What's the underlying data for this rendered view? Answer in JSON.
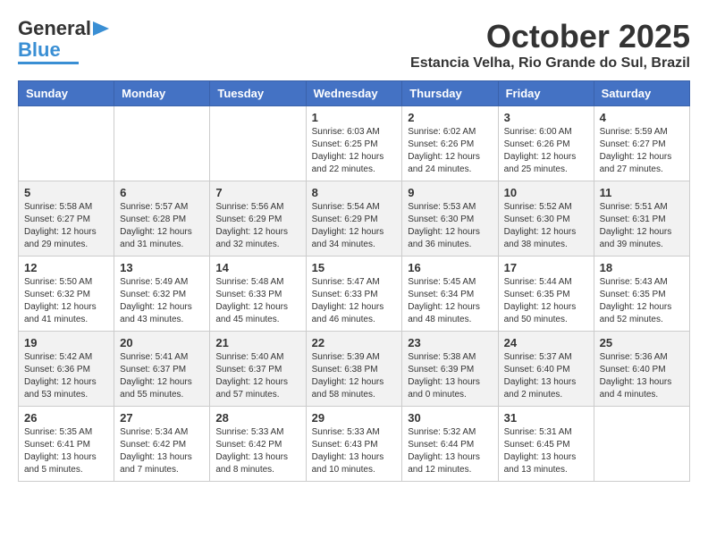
{
  "header": {
    "logo_line1": "General",
    "logo_line2": "Blue",
    "month": "October 2025",
    "location": "Estancia Velha, Rio Grande do Sul, Brazil"
  },
  "weekdays": [
    "Sunday",
    "Monday",
    "Tuesday",
    "Wednesday",
    "Thursday",
    "Friday",
    "Saturday"
  ],
  "weeks": [
    [
      {
        "day": "",
        "info": ""
      },
      {
        "day": "",
        "info": ""
      },
      {
        "day": "",
        "info": ""
      },
      {
        "day": "1",
        "info": "Sunrise: 6:03 AM\nSunset: 6:25 PM\nDaylight: 12 hours\nand 22 minutes."
      },
      {
        "day": "2",
        "info": "Sunrise: 6:02 AM\nSunset: 6:26 PM\nDaylight: 12 hours\nand 24 minutes."
      },
      {
        "day": "3",
        "info": "Sunrise: 6:00 AM\nSunset: 6:26 PM\nDaylight: 12 hours\nand 25 minutes."
      },
      {
        "day": "4",
        "info": "Sunrise: 5:59 AM\nSunset: 6:27 PM\nDaylight: 12 hours\nand 27 minutes."
      }
    ],
    [
      {
        "day": "5",
        "info": "Sunrise: 5:58 AM\nSunset: 6:27 PM\nDaylight: 12 hours\nand 29 minutes."
      },
      {
        "day": "6",
        "info": "Sunrise: 5:57 AM\nSunset: 6:28 PM\nDaylight: 12 hours\nand 31 minutes."
      },
      {
        "day": "7",
        "info": "Sunrise: 5:56 AM\nSunset: 6:29 PM\nDaylight: 12 hours\nand 32 minutes."
      },
      {
        "day": "8",
        "info": "Sunrise: 5:54 AM\nSunset: 6:29 PM\nDaylight: 12 hours\nand 34 minutes."
      },
      {
        "day": "9",
        "info": "Sunrise: 5:53 AM\nSunset: 6:30 PM\nDaylight: 12 hours\nand 36 minutes."
      },
      {
        "day": "10",
        "info": "Sunrise: 5:52 AM\nSunset: 6:30 PM\nDaylight: 12 hours\nand 38 minutes."
      },
      {
        "day": "11",
        "info": "Sunrise: 5:51 AM\nSunset: 6:31 PM\nDaylight: 12 hours\nand 39 minutes."
      }
    ],
    [
      {
        "day": "12",
        "info": "Sunrise: 5:50 AM\nSunset: 6:32 PM\nDaylight: 12 hours\nand 41 minutes."
      },
      {
        "day": "13",
        "info": "Sunrise: 5:49 AM\nSunset: 6:32 PM\nDaylight: 12 hours\nand 43 minutes."
      },
      {
        "day": "14",
        "info": "Sunrise: 5:48 AM\nSunset: 6:33 PM\nDaylight: 12 hours\nand 45 minutes."
      },
      {
        "day": "15",
        "info": "Sunrise: 5:47 AM\nSunset: 6:33 PM\nDaylight: 12 hours\nand 46 minutes."
      },
      {
        "day": "16",
        "info": "Sunrise: 5:45 AM\nSunset: 6:34 PM\nDaylight: 12 hours\nand 48 minutes."
      },
      {
        "day": "17",
        "info": "Sunrise: 5:44 AM\nSunset: 6:35 PM\nDaylight: 12 hours\nand 50 minutes."
      },
      {
        "day": "18",
        "info": "Sunrise: 5:43 AM\nSunset: 6:35 PM\nDaylight: 12 hours\nand 52 minutes."
      }
    ],
    [
      {
        "day": "19",
        "info": "Sunrise: 5:42 AM\nSunset: 6:36 PM\nDaylight: 12 hours\nand 53 minutes."
      },
      {
        "day": "20",
        "info": "Sunrise: 5:41 AM\nSunset: 6:37 PM\nDaylight: 12 hours\nand 55 minutes."
      },
      {
        "day": "21",
        "info": "Sunrise: 5:40 AM\nSunset: 6:37 PM\nDaylight: 12 hours\nand 57 minutes."
      },
      {
        "day": "22",
        "info": "Sunrise: 5:39 AM\nSunset: 6:38 PM\nDaylight: 12 hours\nand 58 minutes."
      },
      {
        "day": "23",
        "info": "Sunrise: 5:38 AM\nSunset: 6:39 PM\nDaylight: 13 hours\nand 0 minutes."
      },
      {
        "day": "24",
        "info": "Sunrise: 5:37 AM\nSunset: 6:40 PM\nDaylight: 13 hours\nand 2 minutes."
      },
      {
        "day": "25",
        "info": "Sunrise: 5:36 AM\nSunset: 6:40 PM\nDaylight: 13 hours\nand 4 minutes."
      }
    ],
    [
      {
        "day": "26",
        "info": "Sunrise: 5:35 AM\nSunset: 6:41 PM\nDaylight: 13 hours\nand 5 minutes."
      },
      {
        "day": "27",
        "info": "Sunrise: 5:34 AM\nSunset: 6:42 PM\nDaylight: 13 hours\nand 7 minutes."
      },
      {
        "day": "28",
        "info": "Sunrise: 5:33 AM\nSunset: 6:42 PM\nDaylight: 13 hours\nand 8 minutes."
      },
      {
        "day": "29",
        "info": "Sunrise: 5:33 AM\nSunset: 6:43 PM\nDaylight: 13 hours\nand 10 minutes."
      },
      {
        "day": "30",
        "info": "Sunrise: 5:32 AM\nSunset: 6:44 PM\nDaylight: 13 hours\nand 12 minutes."
      },
      {
        "day": "31",
        "info": "Sunrise: 5:31 AM\nSunset: 6:45 PM\nDaylight: 13 hours\nand 13 minutes."
      },
      {
        "day": "",
        "info": ""
      }
    ]
  ]
}
